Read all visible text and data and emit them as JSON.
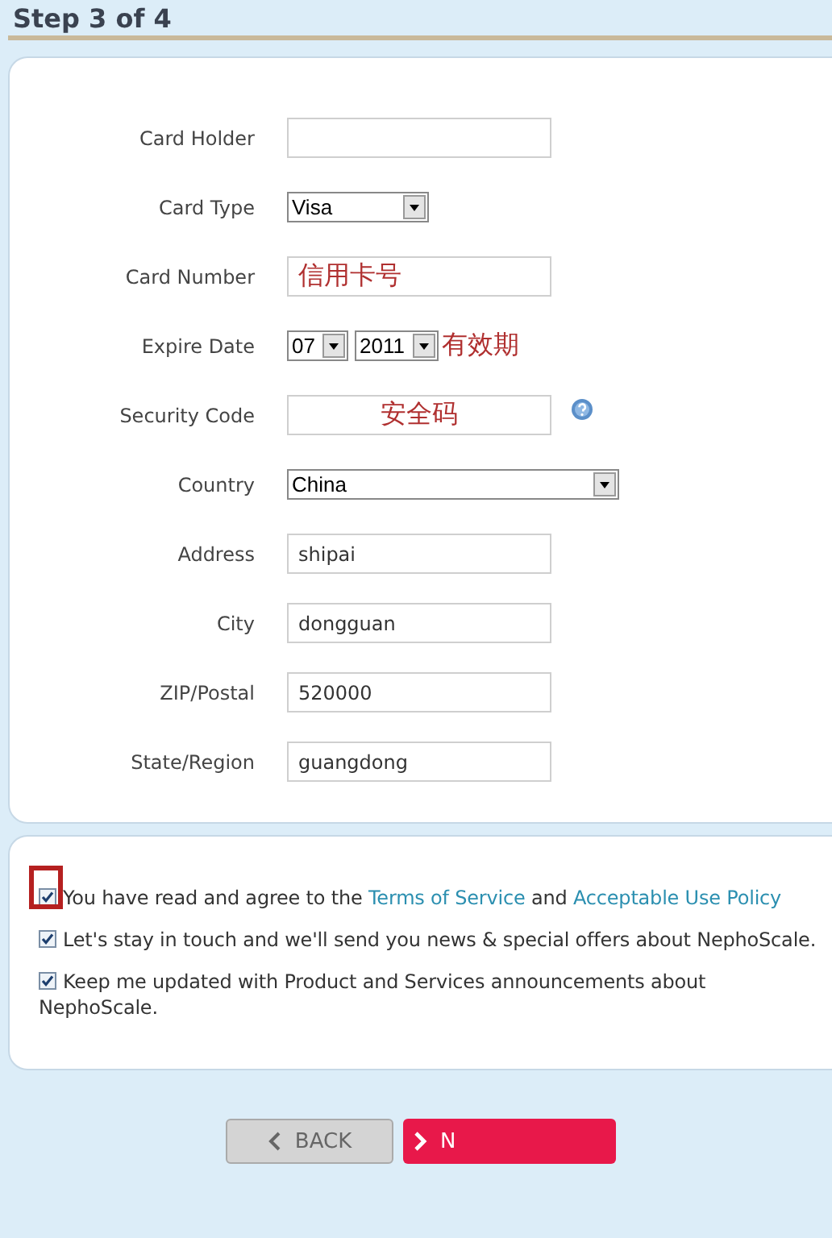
{
  "step_title": "Step 3 of 4",
  "fields": [
    {
      "label": "Card Holder",
      "kind": "text"
    },
    {
      "label": "Card Type",
      "kind": "select",
      "value": "Visa"
    },
    {
      "label": "Card Number",
      "kind": "text",
      "annotation": "信用卡号"
    },
    {
      "label": "Expire Date",
      "kind": "date",
      "month": "07",
      "year": "2011",
      "annotation": "有效期"
    },
    {
      "label": "Security Code",
      "kind": "text",
      "annotation": "安全码",
      "help": true
    },
    {
      "label": "Country",
      "kind": "wide-select",
      "value": "China"
    },
    {
      "label": "Address",
      "kind": "text",
      "value": "shipai"
    },
    {
      "label": "City",
      "kind": "text",
      "value": "dongguan"
    },
    {
      "label": "ZIP/Postal",
      "kind": "text",
      "value": "520000"
    },
    {
      "label": "State/Region",
      "kind": "text",
      "value": "guangdong"
    }
  ],
  "agreements": [
    {
      "checked": true,
      "highlighted": true,
      "parts": [
        {
          "kind": "text",
          "text": "You have read and agree to the "
        },
        {
          "kind": "link",
          "text": "Terms of Service"
        },
        {
          "kind": "text",
          "text": " and "
        },
        {
          "kind": "link",
          "text": "Acceptable Use Policy"
        }
      ]
    },
    {
      "checked": true,
      "highlighted": false,
      "parts": [
        {
          "kind": "text",
          "text": "Let's stay in touch and we'll send you news & special offers about NephoScale."
        }
      ]
    },
    {
      "checked": true,
      "highlighted": false,
      "parts": [
        {
          "kind": "text",
          "text": "Keep me updated with Product and Services announcements about NephoScale."
        }
      ]
    }
  ],
  "buttons": [
    {
      "kind": "back",
      "label": "BACK"
    },
    {
      "kind": "next",
      "label": "N"
    }
  ]
}
